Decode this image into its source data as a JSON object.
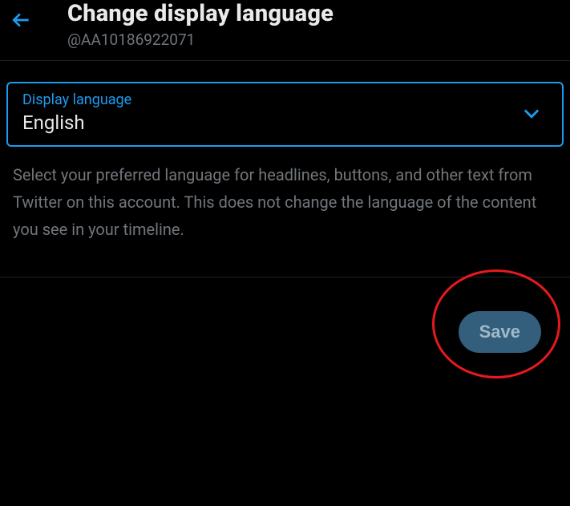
{
  "header": {
    "title": "Change display language",
    "handle": "@AA10186922071"
  },
  "language_select": {
    "label": "Display language",
    "value": "English"
  },
  "description": "Select your preferred language for headlines, buttons, and other text from Twitter on this account. This does not change the language of the content you see in your timeline.",
  "actions": {
    "save_label": "Save"
  }
}
